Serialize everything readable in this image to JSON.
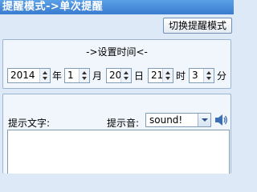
{
  "window": {
    "title": "提醒模式->单次提醒"
  },
  "toolbar": {
    "switch_label": "切换提醒模式"
  },
  "time_section": {
    "title": "->设置时间<-",
    "year": {
      "value": "2014",
      "unit": "年"
    },
    "month": {
      "value": "1",
      "unit": "月"
    },
    "day": {
      "value": "20",
      "unit": "日"
    },
    "hour": {
      "value": "21",
      "unit": "时"
    },
    "minute": {
      "value": "3",
      "unit": "分"
    }
  },
  "text_section": {
    "text_label": "提示文字:",
    "sound_label": "提示音:",
    "sound_selected": "sound!",
    "text_value": ""
  }
}
